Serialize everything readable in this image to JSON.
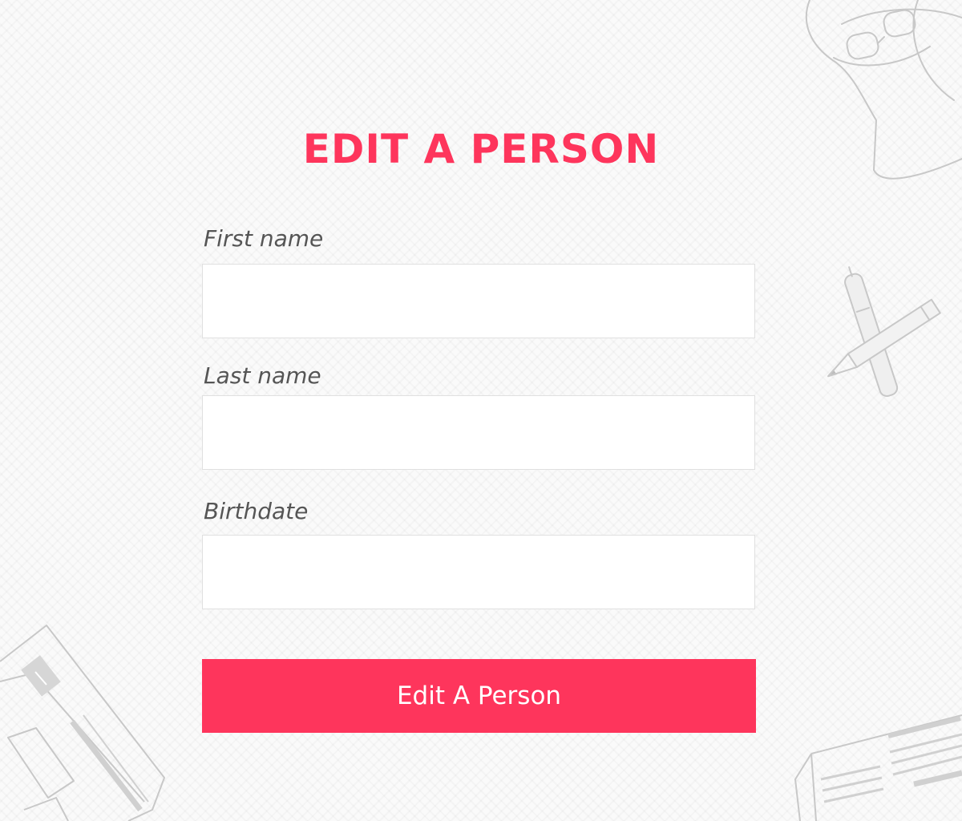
{
  "page": {
    "title": "EDIT A PERSON"
  },
  "form": {
    "fields": [
      {
        "label": "First name",
        "value": "",
        "placeholder": ""
      },
      {
        "label": "Last name",
        "value": "",
        "placeholder": ""
      },
      {
        "label": "Birthdate",
        "value": "",
        "placeholder": ""
      }
    ],
    "submit_label": "Edit A Person"
  },
  "colors": {
    "accent": "#fe355c",
    "label_text": "#555555",
    "input_border": "#e0e0e0",
    "background": "#fafafa",
    "sketch_line": "#c8c8c8"
  },
  "decorations": [
    "head-sketch-icon",
    "pen-and-pencil-icon",
    "envelope-sketch-icon",
    "newspaper-sketch-icon"
  ]
}
